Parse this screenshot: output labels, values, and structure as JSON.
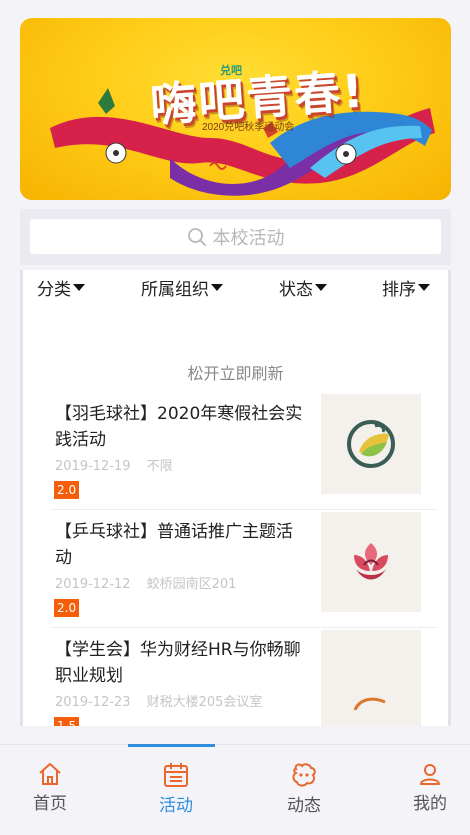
{
  "banner": {
    "brand": "兑吧",
    "title": "嗨吧青春!",
    "subtitle": "2020兑吧秋季运动会"
  },
  "search": {
    "placeholder": "本校活动",
    "icon": "search-icon"
  },
  "filters": [
    {
      "label": "分类"
    },
    {
      "label": "所属组织"
    },
    {
      "label": "状态"
    },
    {
      "label": "排序"
    }
  ],
  "refresh_hint": "松开立即刷新",
  "activities": [
    {
      "title": "【羽毛球社】2020年寒假社会实践活动",
      "date": "2019-12-19",
      "location": "不限",
      "badge": "2.0",
      "thumb": "leaf-logo"
    },
    {
      "title": "【乒乓球社】普通话推广主题活动",
      "date": "2019-12-12",
      "location": "蛟桥园南区201",
      "badge": "2.0",
      "thumb": "flower-logo"
    },
    {
      "title": "【学生会】华为财经HR与你畅聊职业规划",
      "date": "2019-12-23",
      "location": "财税大楼205会议室",
      "badge": "1.5",
      "thumb": "logo"
    }
  ],
  "tabbar": {
    "items": [
      {
        "label": "首页",
        "icon": "home-icon"
      },
      {
        "label": "活动",
        "icon": "calendar-icon",
        "active": true
      },
      {
        "label": "动态",
        "icon": "feed-icon"
      },
      {
        "label": "我的",
        "icon": "user-icon"
      }
    ]
  },
  "colors": {
    "accent": "#2e8fe0",
    "badge": "#f55d0a",
    "icon_orange": "#e8682e"
  }
}
